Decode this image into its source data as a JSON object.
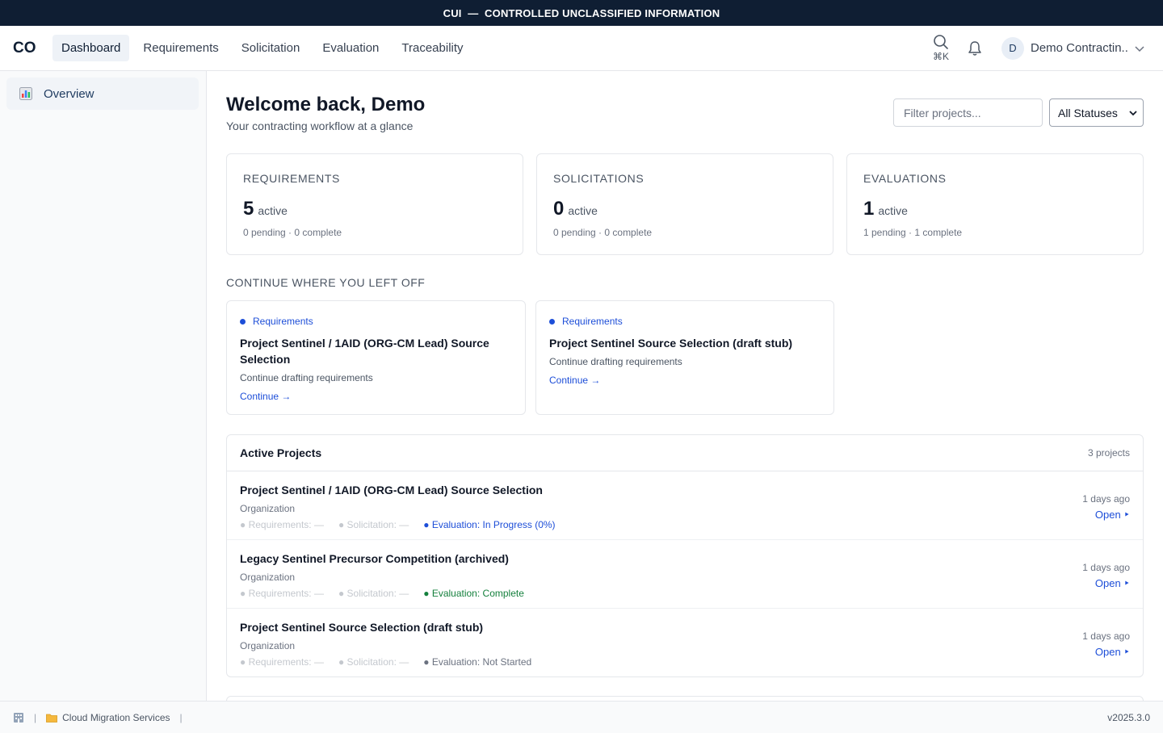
{
  "banner": {
    "text": "CUI  —  CONTROLLED UNCLASSIFIED INFORMATION"
  },
  "header": {
    "logo": "CO",
    "tabs": [
      {
        "label": "Dashboard",
        "active": true
      },
      {
        "label": "Requirements",
        "active": false
      },
      {
        "label": "Solicitation",
        "active": false
      },
      {
        "label": "Evaluation",
        "active": false
      },
      {
        "label": "Traceability",
        "active": false
      }
    ],
    "search_shortcut": "⌘K",
    "user": {
      "initial": "D",
      "name": "Demo Contractin..."
    }
  },
  "sidebar": {
    "items": [
      {
        "label": "Overview",
        "icon": "chart-icon"
      }
    ]
  },
  "welcome": {
    "title": "Welcome back, Demo",
    "subtitle": "Your contracting workflow at a glance"
  },
  "filters": {
    "placeholder": "Filter projects...",
    "status_selected": "All Statuses"
  },
  "stats": [
    {
      "title": "REQUIREMENTS",
      "count": "5",
      "label": "active",
      "sub": "0 pending · 0 complete"
    },
    {
      "title": "SOLICITATIONS",
      "count": "0",
      "label": "active",
      "sub": "0 pending · 0 complete"
    },
    {
      "title": "EVALUATIONS",
      "count": "1",
      "label": "active",
      "sub": "1 pending · 1 complete"
    }
  ],
  "continue_section": {
    "title": "CONTINUE WHERE YOU LEFT OFF",
    "cards": [
      {
        "tag": "Requirements",
        "title": "Project Sentinel / 1AID (ORG-CM Lead) Source Selection",
        "desc": "Continue drafting requirements",
        "link": "Continue →"
      },
      {
        "tag": "Requirements",
        "title": "Project Sentinel Source Selection (draft stub)",
        "desc": "Continue drafting requirements",
        "link": "Continue →"
      }
    ]
  },
  "projects": {
    "title": "Active Projects",
    "count": "3 projects",
    "rows": [
      {
        "name": "Project Sentinel / 1AID (ORG-CM Lead) Source Selection",
        "org": "Organization",
        "req": "● Requirements: —",
        "sol": "● Solicitation: —",
        "eval": "● Evaluation: In Progress (0%)",
        "ago": "1 days ago",
        "open": "Open ‣"
      },
      {
        "name": "Legacy Sentinel Precursor Competition (archived)",
        "org": "Organization",
        "req": "● Requirements: —",
        "sol": "● Solicitation: —",
        "eval": "● Evaluation: Complete",
        "ago": "1 days ago",
        "open": "Open ‣"
      },
      {
        "name": "Project Sentinel Source Selection (draft stub)",
        "org": "Organization",
        "req": "● Requirements: —",
        "sol": "● Solicitation: —",
        "eval": "● Evaluation: Not Started",
        "ago": "1 days ago",
        "open": "Open ‣"
      }
    ]
  },
  "footer": {
    "workspace": "Cloud Migration Services",
    "version": "v2025.3.0"
  },
  "colors": {
    "banner": "#0f1e33",
    "accent": "#1d4ed8",
    "success": "#15803d"
  }
}
